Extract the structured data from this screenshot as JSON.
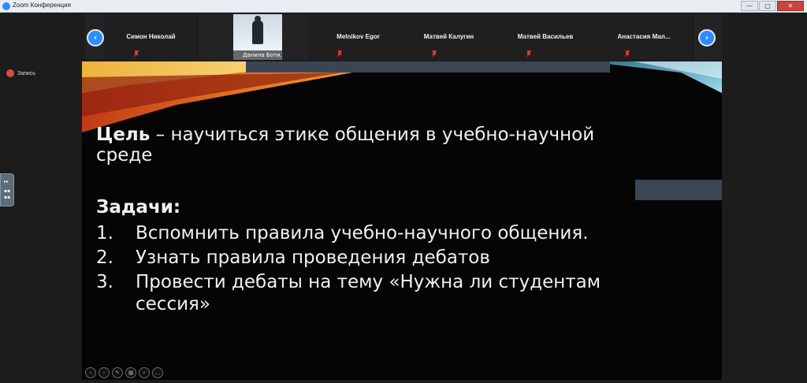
{
  "window": {
    "title": "Zoom Конференция",
    "buttons": [
      "—",
      "□",
      "✕"
    ]
  },
  "participants_strip": {
    "prev_icon": "‹",
    "next_icon": "›",
    "tiles": [
      {
        "name": "Симон Николай"
      },
      {
        "name": "Данила Боти..."
      },
      {
        "name": "Melnikov Egor"
      },
      {
        "name": "Матвей Калугин"
      },
      {
        "name": "Матвей Васильев"
      },
      {
        "name": "Анастасия Мал..."
      }
    ]
  },
  "recording": {
    "label": "Запись"
  },
  "slide": {
    "goal_bold": "Цель",
    "goal_rest": " – научиться этике общения в учебно-научной среде",
    "tasks_title": "Задачи:",
    "tasks": [
      {
        "num": "1.",
        "text": "Вспомнить правила учебно-научного общения."
      },
      {
        "num": "2.",
        "text": "Узнать правила проведения дебатов"
      },
      {
        "num": "3.",
        "text": "Провести дебаты на тему «Нужна ли студентам сессия»"
      }
    ]
  },
  "slide_controls": [
    "‹",
    "›",
    "✎",
    "▦",
    "⌕",
    "…"
  ],
  "colors": {
    "accent": "#2d8cff",
    "record": "#d74c3c",
    "slide_bg": "#050505"
  }
}
